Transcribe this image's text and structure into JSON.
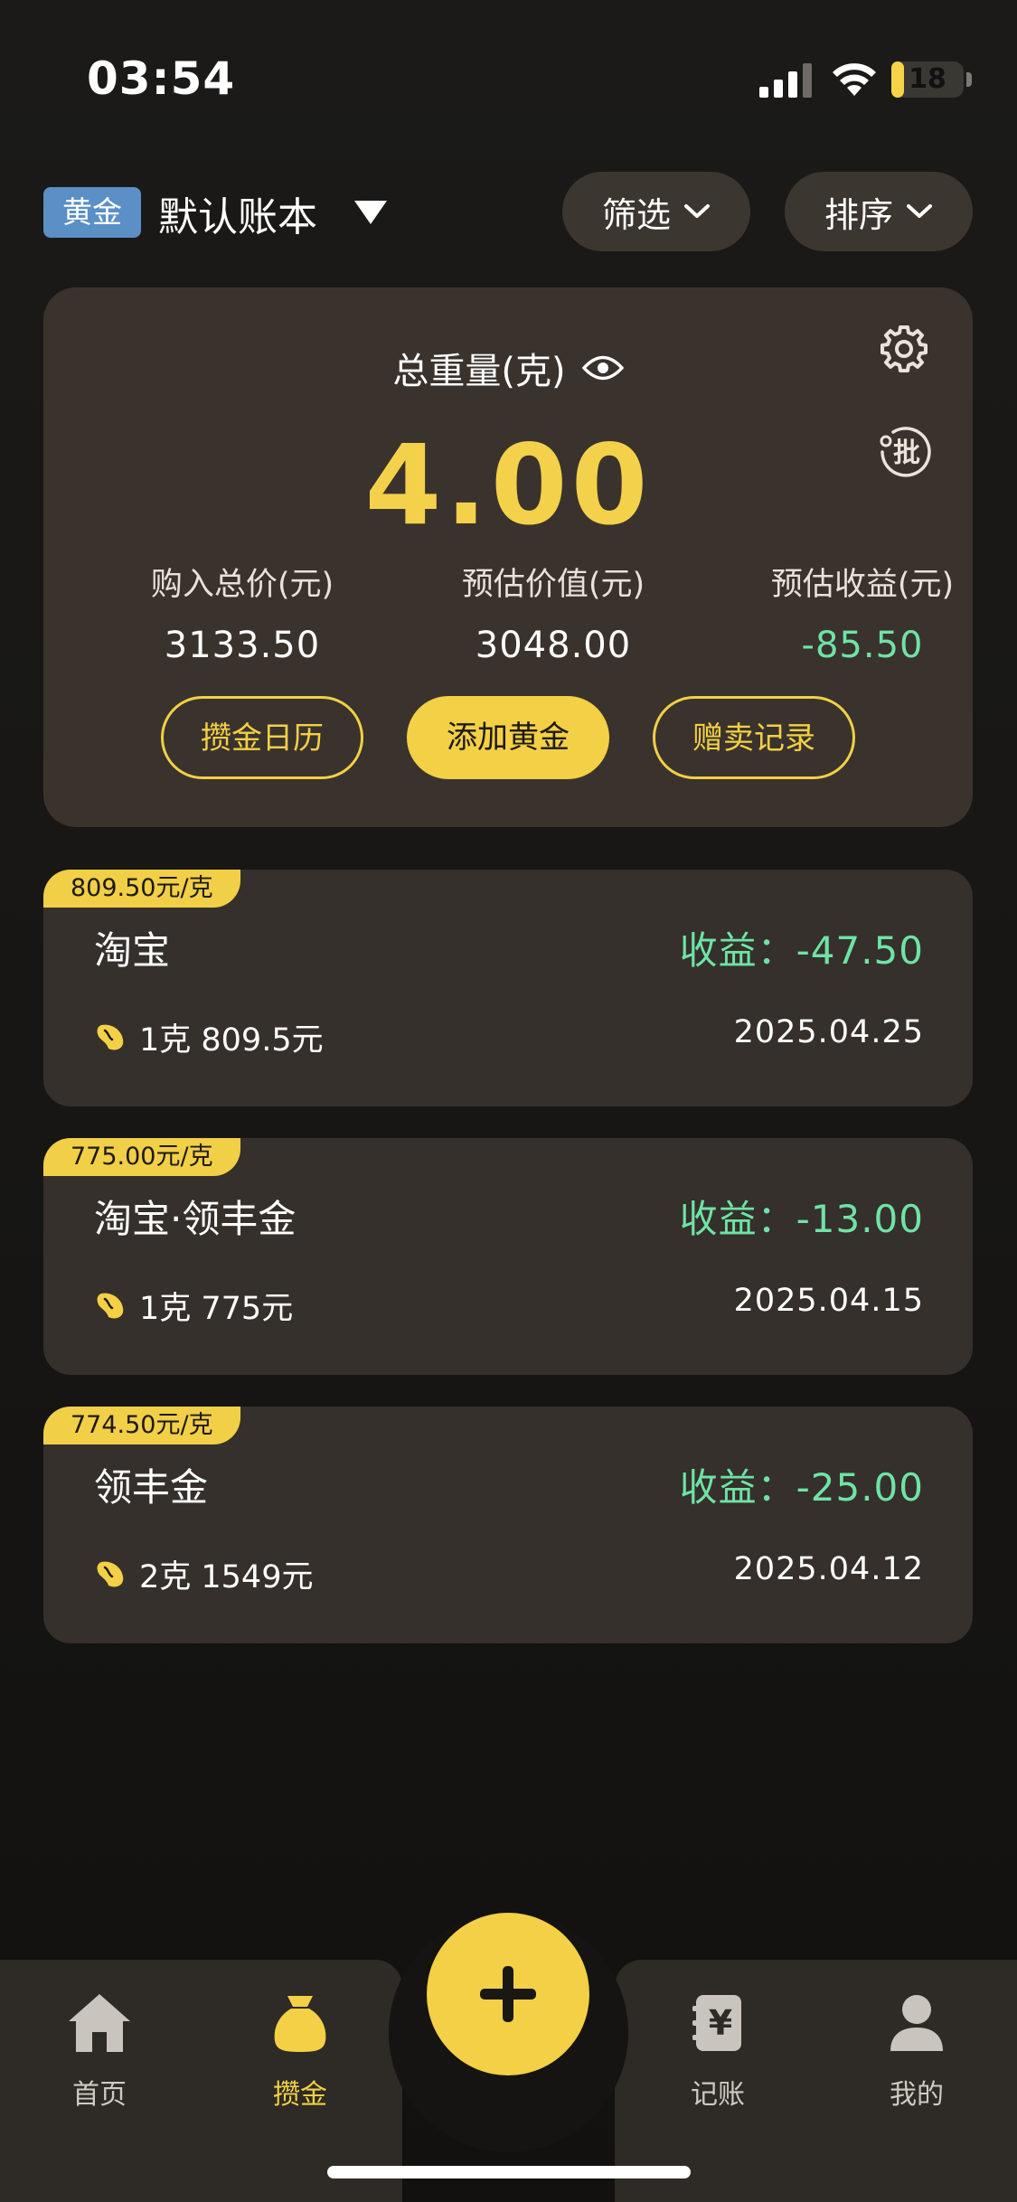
{
  "status_bar": {
    "time": "03:54",
    "battery": "18",
    "battery_fraction": 0.18,
    "icons": [
      "signal-icon",
      "wifi-icon",
      "battery-icon"
    ]
  },
  "header": {
    "asset_tag": "黄金",
    "book_title": "默认账本",
    "filter_label": "筛选",
    "sort_label": "排序"
  },
  "summary": {
    "weight_label": "总重量(克)",
    "weight_value": "4.00",
    "stats": [
      {
        "label": "购入总价(元)",
        "value": "3133.50"
      },
      {
        "label": "预估价值(元)",
        "value": "3048.00"
      },
      {
        "label": "预估收益(元)",
        "value": "-85.50"
      }
    ],
    "buttons": {
      "calendar": "攒金日历",
      "add_gold": "添加黄金",
      "sell_records": "赠卖记录"
    },
    "batch_icon_text": "批"
  },
  "records": [
    {
      "price_tag": "809.50元/克",
      "name": "淘宝",
      "profit": "收益：-47.50",
      "amount": "1克 809.5元",
      "date": "2025.04.25"
    },
    {
      "price_tag": "775.00元/克",
      "name": "淘宝·领丰金",
      "profit": "收益：-13.00",
      "amount": "1克 775元",
      "date": "2025.04.15"
    },
    {
      "price_tag": "774.50元/克",
      "name": "领丰金",
      "profit": "收益：-25.00",
      "amount": "2克 1549元",
      "date": "2025.04.12"
    }
  ],
  "tab_bar": {
    "tabs": [
      {
        "label": "首页",
        "icon": "home-icon"
      },
      {
        "label": "攒金",
        "icon": "money-bag-icon",
        "active": true
      },
      {
        "label": "记账",
        "icon": "ledger-icon"
      },
      {
        "label": "我的",
        "icon": "profile-icon"
      }
    ],
    "ledger_icon_glyph": "¥"
  },
  "colors": {
    "accent_gold": "#f3d045",
    "profit_green": "#6fe3a6",
    "card_bg": "#3a332d",
    "tag_blue": "#5b8fc6"
  }
}
